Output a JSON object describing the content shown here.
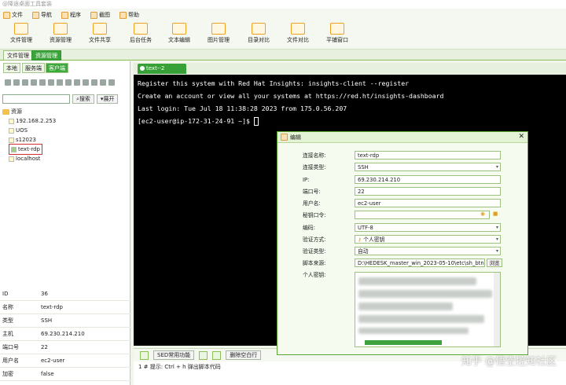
{
  "window": {
    "title": "@降途桌面工具套装"
  },
  "menu": [
    {
      "label": "文件",
      "icon": "file-icon"
    },
    {
      "label": "导航",
      "icon": "nav-icon"
    },
    {
      "label": "程序",
      "icon": "program-icon"
    },
    {
      "label": "截图",
      "icon": "screenshot-icon"
    },
    {
      "label": "帮助",
      "icon": "help-icon"
    }
  ],
  "toolbar": [
    {
      "label": "文件管理",
      "icon": "folder-manage-icon"
    },
    {
      "label": "资源管理",
      "icon": "resource-icon"
    },
    {
      "label": "文件共享",
      "icon": "share-icon"
    },
    {
      "label": "后台任务",
      "icon": "monitor-icon"
    },
    {
      "label": "文本编辑",
      "icon": "text-edit-icon"
    },
    {
      "label": "图片管理",
      "icon": "image-icon"
    },
    {
      "label": "目录对比",
      "icon": "dir-compare-icon"
    },
    {
      "label": "文件对比",
      "icon": "file-compare-icon"
    },
    {
      "label": "平铺窗口",
      "icon": "tile-icon"
    }
  ],
  "outer_tabs": [
    "文件管理",
    "资源管理"
  ],
  "sub_tabs": [
    "本地",
    "服务端",
    "客户端"
  ],
  "search": {
    "button": "搜索",
    "expand": "展开"
  },
  "tree": {
    "root": "资源",
    "nodes": [
      "192.168.2.253",
      "UOS",
      "s12023",
      "text-rdp",
      "localhost"
    ]
  },
  "props": [
    {
      "key": "ID",
      "value": "36"
    },
    {
      "key": "名称",
      "value": "text-rdp"
    },
    {
      "key": "类型",
      "value": "SSH"
    },
    {
      "key": "主机",
      "value": "69.230.214.210"
    },
    {
      "key": "端口号",
      "value": "22"
    },
    {
      "key": "用户名",
      "value": "ec2-user"
    },
    {
      "key": "加密",
      "value": "false"
    }
  ],
  "terminal": {
    "tab": "text--2",
    "lines": [
      "Register this system with Red Hat Insights: insights-client --register",
      "Create an account or view all your systems at https://red.ht/insights-dashboard",
      "Last login: Tue Jul 18 11:38:28 2023 from 175.0.56.207",
      "[ec2-user@ip-172-31-24-91 ~]$ "
    ]
  },
  "scriptbar": {
    "dropdown": "SED常用功能",
    "remove": "删除空白行",
    "hint": "1  # 提示: Ctrl + h 弹出脚本代码"
  },
  "dialog": {
    "title": "编辑",
    "fields": [
      {
        "label": "连接名称:",
        "value": "text-rdp",
        "select": false
      },
      {
        "label": "连接类型:",
        "value": "SSH",
        "select": true
      },
      {
        "label": "IP:",
        "value": "69.230.214.210",
        "select": false
      },
      {
        "label": "端口号:",
        "value": "22",
        "select": false
      },
      {
        "label": "用户名:",
        "value": "ec2-user",
        "select": false
      },
      {
        "label": "秘钥口令:",
        "value": "",
        "select": false
      },
      {
        "label": "编码:",
        "value": "UTF-8",
        "select": true
      },
      {
        "label": "验证方式:",
        "value": "个人密钥",
        "select": true
      },
      {
        "label": "验证类型:",
        "value": "自动",
        "select": true
      },
      {
        "label": "脚本来源:",
        "value": "D:\\HEDESK_master_win_2023-05-10\\etc\\sh_btn",
        "select": false
      }
    ],
    "browse": "浏览",
    "key_label": "个人密钥:"
  },
  "watermark": "知乎 @悟空控知社区"
}
